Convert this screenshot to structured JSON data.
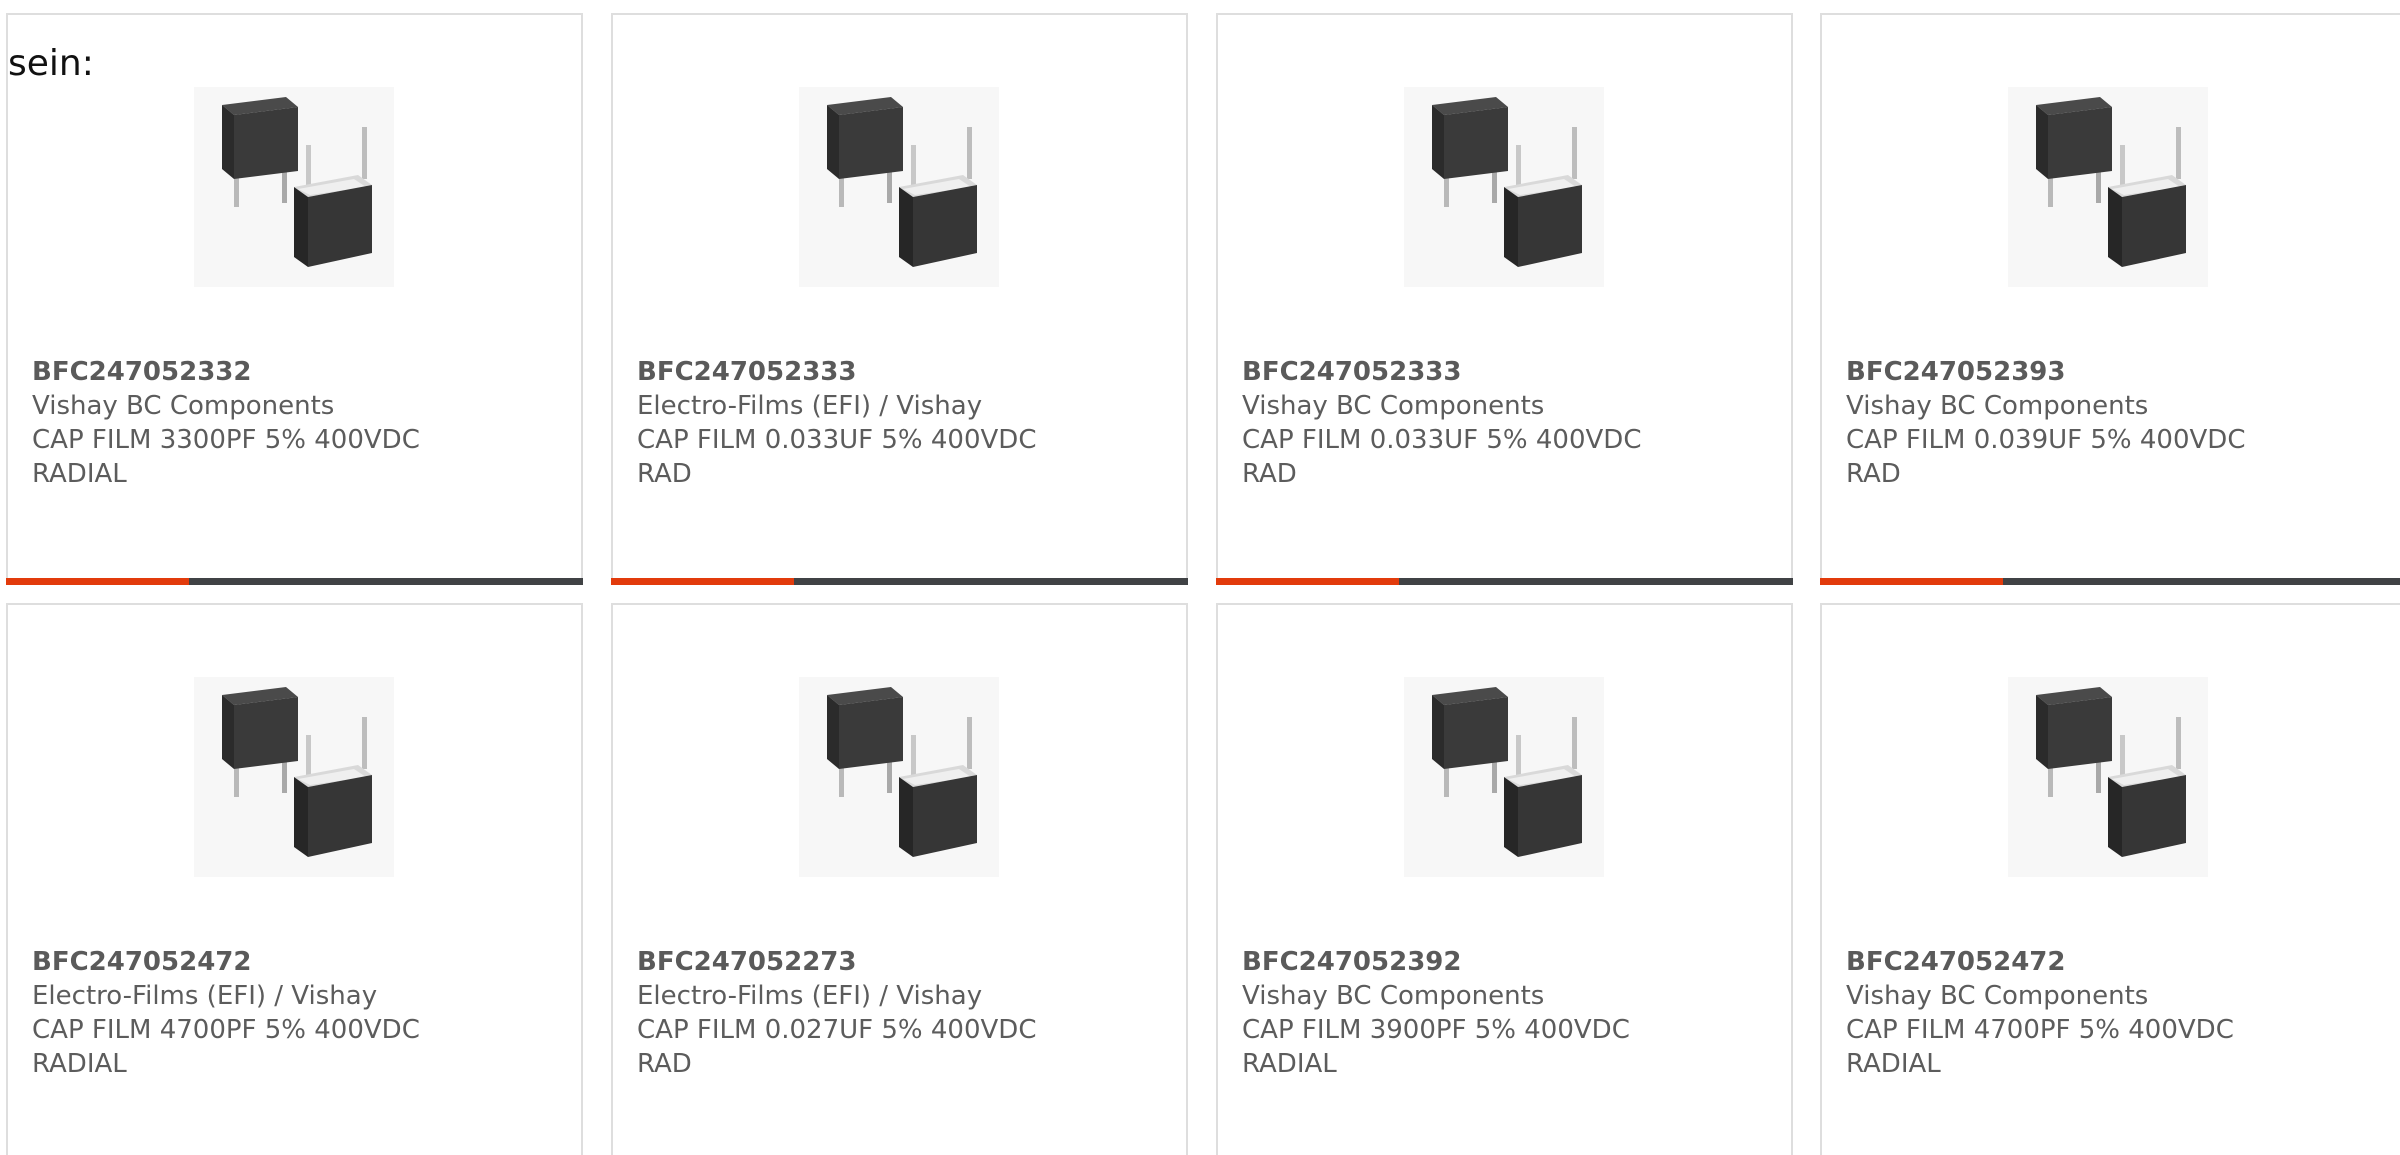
{
  "intro": {
    "text": "sein:"
  },
  "colors": {
    "accent_bar": "#e23b0c",
    "base_bar": "#404245",
    "card_border": "#dedede",
    "text": "#5c5c5c"
  },
  "product_image": {
    "icon": "film-capacitor-product-image"
  },
  "cards": [
    {
      "part_number": "BFC247052332",
      "manufacturer": "Vishay BC Components",
      "desc1": "CAP FILM 3300PF 5% 400VDC",
      "desc2": "RADIAL"
    },
    {
      "part_number": "BFC247052333",
      "manufacturer": "Electro-Films (EFI) / Vishay",
      "desc1": "CAP FILM 0.033UF 5% 400VDC",
      "desc2": "RAD"
    },
    {
      "part_number": "BFC247052333",
      "manufacturer": "Vishay BC Components",
      "desc1": "CAP FILM 0.033UF 5% 400VDC",
      "desc2": "RAD"
    },
    {
      "part_number": "BFC247052393",
      "manufacturer": "Vishay BC Components",
      "desc1": "CAP FILM 0.039UF 5% 400VDC",
      "desc2": "RAD"
    },
    {
      "part_number": "BFC247052472",
      "manufacturer": "Electro-Films (EFI) / Vishay",
      "desc1": "CAP FILM 4700PF 5% 400VDC",
      "desc2": "RADIAL"
    },
    {
      "part_number": "BFC247052273",
      "manufacturer": "Electro-Films (EFI) / Vishay",
      "desc1": "CAP FILM 0.027UF 5% 400VDC",
      "desc2": "RAD"
    },
    {
      "part_number": "BFC247052392",
      "manufacturer": "Vishay BC Components",
      "desc1": "CAP FILM 3900PF 5% 400VDC",
      "desc2": "RADIAL"
    },
    {
      "part_number": "BFC247052472",
      "manufacturer": "Vishay BC Components",
      "desc1": "CAP FILM 4700PF 5% 400VDC",
      "desc2": "RADIAL"
    }
  ]
}
